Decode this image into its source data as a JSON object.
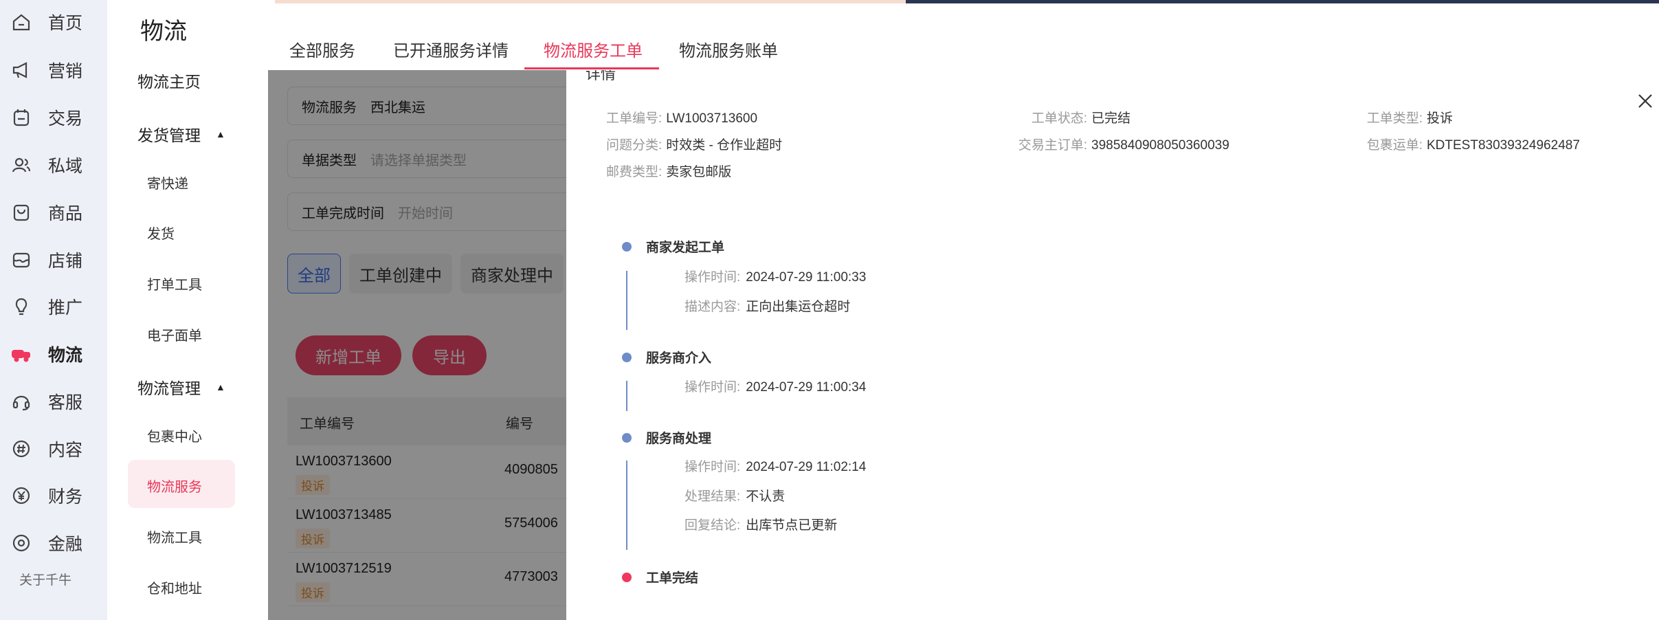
{
  "rail": {
    "items": [
      {
        "label": "首页",
        "icon": "home-icon"
      },
      {
        "label": "营销",
        "icon": "megaphone-icon"
      },
      {
        "label": "交易",
        "icon": "calendar-icon"
      },
      {
        "label": "私域",
        "icon": "users-icon"
      },
      {
        "label": "商品",
        "icon": "bag-icon"
      },
      {
        "label": "店铺",
        "icon": "store-icon"
      },
      {
        "label": "推广",
        "icon": "bulb-icon"
      },
      {
        "label": "物流",
        "icon": "truck-icon"
      },
      {
        "label": "客服",
        "icon": "headset-icon"
      },
      {
        "label": "内容",
        "icon": "hash-icon"
      },
      {
        "label": "财务",
        "icon": "yen-icon"
      },
      {
        "label": "金融",
        "icon": "coin-icon"
      }
    ],
    "about": "关于千牛"
  },
  "subnav": {
    "title": "物流",
    "home": "物流主页",
    "group1": "发货管理",
    "group1_items": [
      "寄快递",
      "发货",
      "打单工具",
      "电子面单"
    ],
    "group2": "物流管理",
    "group2_items": [
      "包裹中心",
      "物流服务",
      "物流工具",
      "仓和地址"
    ]
  },
  "tabs": [
    "全部服务",
    "已开通服务详情",
    "物流服务工单",
    "物流服务账单"
  ],
  "filters": {
    "service_label": "物流服务",
    "service_value": "西北集运",
    "doc_type_label": "单据类型",
    "doc_type_placeholder": "请选择单据类型",
    "finish_time_label": "工单完成时间",
    "finish_time_placeholder": "开始时间"
  },
  "chips": [
    "全部",
    "工单创建中",
    "商家处理中"
  ],
  "actions": {
    "new": "新增工单",
    "export": "导出"
  },
  "table": {
    "headers": [
      "工单编号",
      "编号"
    ],
    "rows": [
      {
        "id": "LW1003713600",
        "tag": "投诉",
        "num": "4090805"
      },
      {
        "id": "LW1003713485",
        "tag": "投诉",
        "num": "5754006"
      },
      {
        "id": "LW1003712519",
        "tag": "投诉",
        "num": "4773003"
      }
    ]
  },
  "drawer": {
    "title": "详情",
    "info": {
      "order_no_label": "工单编号:",
      "order_no": "LW1003713600",
      "status_label": "工单状态:",
      "status": "已完结",
      "type_label": "工单类型:",
      "type": "投诉",
      "category_label": "问题分类:",
      "category": "时效类 - 仓作业超时",
      "trade_label": "交易主订单:",
      "trade": "3985840908050360039",
      "package_label": "包裹运单:",
      "package": "KDTEST83039324962487",
      "postage_label": "邮费类型:",
      "postage": "卖家包邮版"
    },
    "timeline": [
      {
        "title": "商家发起工单",
        "rows": [
          {
            "label": "操作时间:",
            "value": "2024-07-29 11:00:33"
          },
          {
            "label": "描述内容:",
            "value": "正向出集运仓超时"
          }
        ]
      },
      {
        "title": "服务商介入",
        "rows": [
          {
            "label": "操作时间:",
            "value": "2024-07-29 11:00:34"
          }
        ]
      },
      {
        "title": "服务商处理",
        "rows": [
          {
            "label": "操作时间:",
            "value": "2024-07-29 11:02:14"
          },
          {
            "label": "处理结果:",
            "value": "不认责"
          },
          {
            "label": "回复结论:",
            "value": "出库节点已更新"
          }
        ]
      },
      {
        "title": "工单完结",
        "rows": []
      }
    ]
  },
  "colors": {
    "accent": "#e8385a",
    "timeline": "#6f8cc8",
    "final_dot": "#f0375f"
  }
}
